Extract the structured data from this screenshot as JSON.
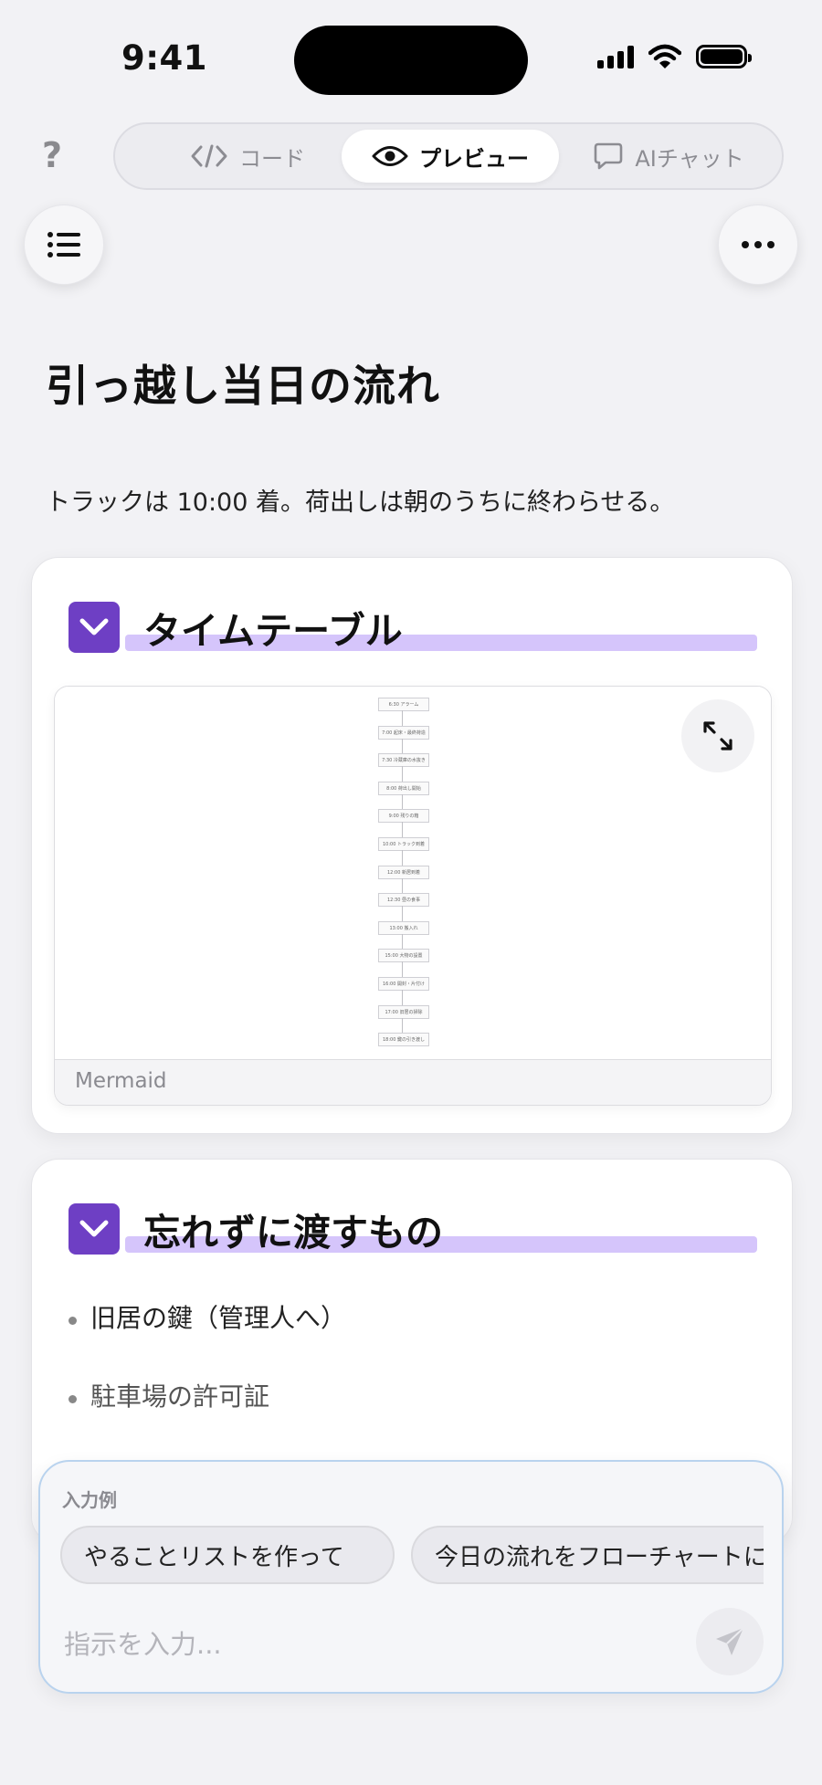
{
  "status": {
    "time": "9:41"
  },
  "nav": {
    "help_label": "?",
    "tabs": [
      {
        "label": "コード",
        "icon": "code-icon"
      },
      {
        "label": "プレビュー",
        "icon": "eye-icon"
      },
      {
        "label": "AIチャット",
        "icon": "chat-bubble-icon"
      }
    ],
    "active_tab": "プレビュー"
  },
  "document": {
    "title": "引っ越し当日の流れ",
    "intro": "トラックは 10:00 着。荷出しは朝のうちに終わらせる。",
    "sections": [
      {
        "title": "タイムテーブル",
        "diagram": {
          "label": "Mermaid",
          "nodes": [
            "6:30 アラーム",
            "7:00 起床・最終荷造",
            "7:30 冷蔵庫の水抜き",
            "8:00 荷出し開始",
            "9:00 残りの箱",
            "10:00 トラック到着",
            "12:00 新居到着",
            "12:30 昼の食事",
            "13:00 搬入れ",
            "15:00 大物の設置",
            "16:00 開封・片付け",
            "17:00 旧居の掃除",
            "18:00 鍵の引き渡し"
          ]
        }
      },
      {
        "title": "忘れずに渡すもの",
        "items": [
          "旧居の鍵（管理人へ）",
          "駐車場の許可証"
        ]
      }
    ]
  },
  "composer": {
    "examples_label": "入力例",
    "examples": [
      "やることリストを作って",
      "今日の流れをフローチャートにして"
    ],
    "placeholder": "指示を入力..."
  },
  "colors": {
    "accent": "#6e3fc4",
    "highlight": "#d5c5fb",
    "composer_border": "#b9d3ee"
  }
}
